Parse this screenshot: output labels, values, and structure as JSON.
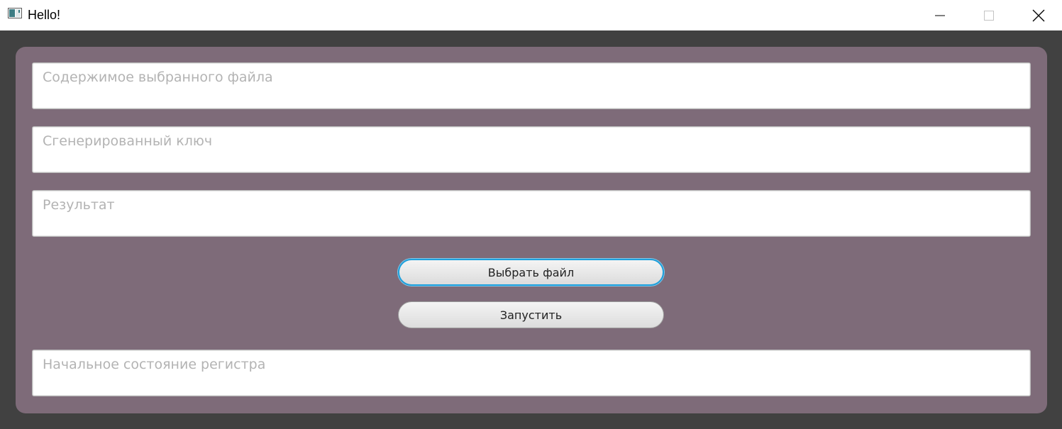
{
  "window": {
    "title": "Hello!"
  },
  "fields": {
    "file_content_placeholder": "Содержимое выбранного файла",
    "generated_key_placeholder": "Сгенерированный ключ",
    "result_placeholder": "Результат",
    "register_state_placeholder": "Начальное состояние регистра"
  },
  "buttons": {
    "choose_file": "Выбрать файл",
    "run": "Запустить"
  },
  "colors": {
    "panel": "#7e6b79",
    "background": "#414141",
    "focus": "#1ea0dc"
  }
}
